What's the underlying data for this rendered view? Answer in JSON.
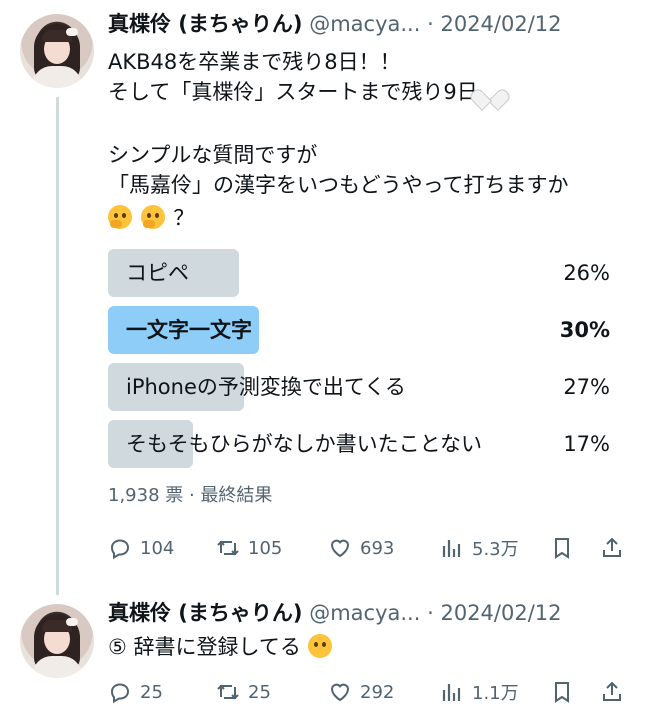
{
  "tweets": [
    {
      "name": "真楪伶 (まちゃりん)",
      "handle": "@macya...",
      "dot": "·",
      "date": "2024/02/12",
      "lines": [
        "AKB48を卒業まで残り8日！！",
        "そして「真楪伶」スタートまで残り9日",
        "シンプルな質問ですが",
        "「馬嘉伶」の漢字をいつもどうやって打ちますか",
        "？"
      ],
      "poll": {
        "options": [
          {
            "label": "コピペ",
            "percent": "26%",
            "fraction": 0.26
          },
          {
            "label": "一文字一文字",
            "percent": "30%",
            "fraction": 0.3,
            "winner": true
          },
          {
            "label": "iPhoneの予測変換で出てくる",
            "percent": "27%",
            "fraction": 0.27
          },
          {
            "label": "そもそもひらがなしか書いたことない",
            "percent": "17%",
            "fraction": 0.17
          }
        ],
        "meta": "1,938 票 · 最終結果"
      },
      "actions": {
        "replies": "104",
        "retweets": "105",
        "likes": "693",
        "views": "5.3万"
      }
    },
    {
      "name": "真楪伶 (まちゃりん)",
      "handle": "@macya...",
      "dot": "·",
      "date": "2024/02/12",
      "text": "⑤ 辞書に登録してる",
      "actions": {
        "replies": "25",
        "retweets": "25",
        "likes": "292",
        "views": "1.1万"
      }
    }
  ],
  "icons": {
    "reply": "reply-icon",
    "retweet": "retweet-icon",
    "like": "heart-icon",
    "views": "views-icon",
    "bookmark": "bookmark-icon",
    "share": "share-icon"
  },
  "colors": {
    "text": "#0f1419",
    "muted": "#536471",
    "poll_bar": "#cfd9de",
    "poll_winner": "#8ecdf7",
    "thread_line": "#cfd9de"
  }
}
